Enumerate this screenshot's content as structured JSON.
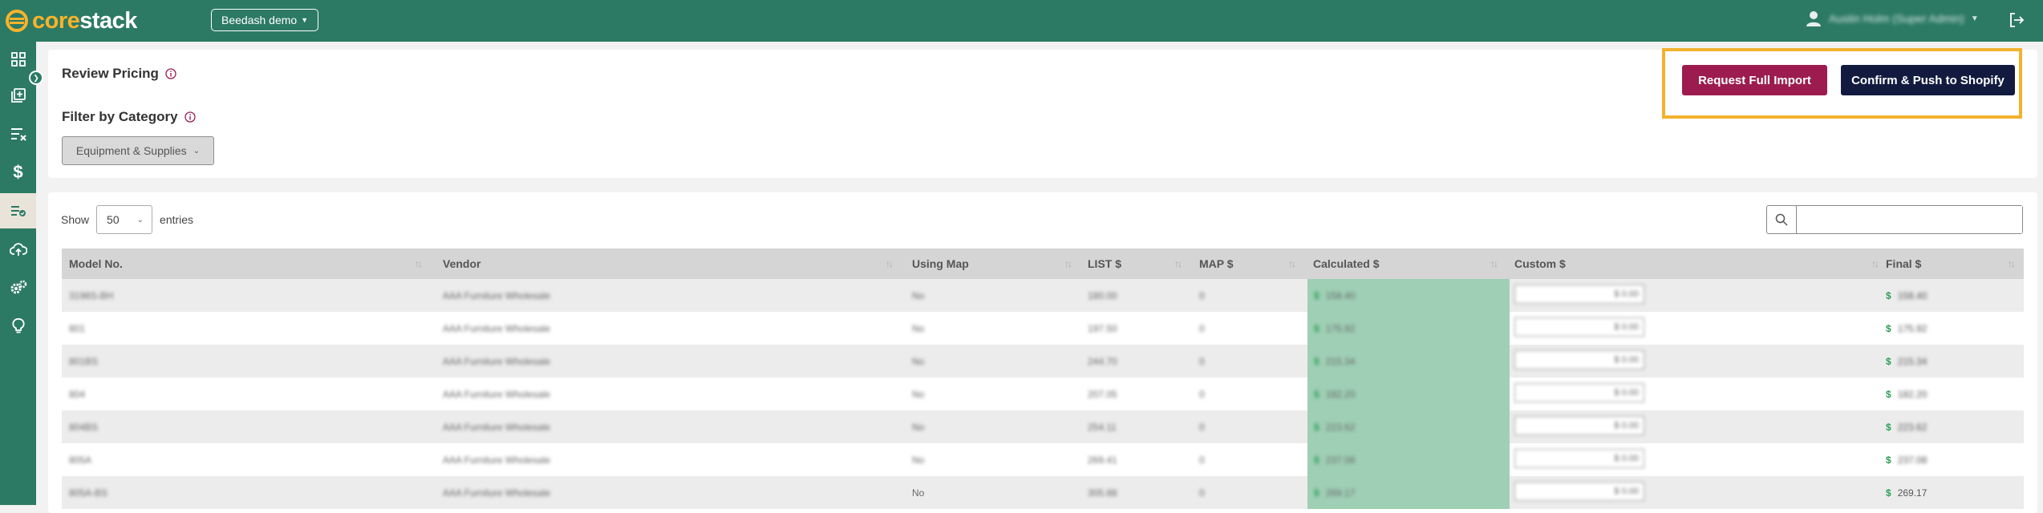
{
  "brand": {
    "core": "core",
    "stack": "stack",
    "logo_color": "#f7b32b"
  },
  "header": {
    "org_select": "Beedash demo",
    "user_name": "Austin Holm (Super Admin)"
  },
  "colors": {
    "topbar": "#2c7a64",
    "import_button": "#9c1c4f",
    "push_button": "#121b3f",
    "highlight": "#f2b22f",
    "calculated": "#9fcfb5"
  },
  "sidebar": {
    "items": [
      {
        "icon": "dashboard-icon"
      },
      {
        "icon": "catalog-icon"
      },
      {
        "icon": "sort-filter-icon"
      },
      {
        "icon": "dollar-icon"
      },
      {
        "icon": "review-list-icon",
        "active": true
      },
      {
        "icon": "cloud-upload-icon"
      },
      {
        "icon": "settings-gears-icon"
      },
      {
        "icon": "lightbulb-icon"
      }
    ]
  },
  "review": {
    "title": "Review Pricing",
    "filter_title": "Filter by Category",
    "category": "Equipment & Supplies",
    "request_import": "Request Full Import",
    "confirm_push": "Confirm & Push to Shopify"
  },
  "table_controls": {
    "show": "Show",
    "entries_value": "50",
    "entries": "entries",
    "search_placeholder": ""
  },
  "table": {
    "columns": [
      "Model No.",
      "Vendor",
      "Using Map",
      "LIST $",
      "MAP $",
      "Calculated $",
      "Custom $",
      "Final $"
    ],
    "rows": [
      {
        "model": "3198S-BH",
        "vendor": "AAA Furniture Wholesale",
        "using_map": "No",
        "list": "180.00",
        "map": "0",
        "calculated": "158.40",
        "custom": "$ 0.00",
        "final": "158.40"
      },
      {
        "model": "801",
        "vendor": "AAA Furniture Wholesale",
        "using_map": "No",
        "list": "197.50",
        "map": "0",
        "calculated": "175.92",
        "custom": "$ 0.00",
        "final": "175.92"
      },
      {
        "model": "801BS",
        "vendor": "AAA Furniture Wholesale",
        "using_map": "No",
        "list": "244.70",
        "map": "0",
        "calculated": "215.34",
        "custom": "$ 0.00",
        "final": "215.34"
      },
      {
        "model": "804",
        "vendor": "AAA Furniture Wholesale",
        "using_map": "No",
        "list": "207.05",
        "map": "0",
        "calculated": "182.20",
        "custom": "$ 0.00",
        "final": "182.20"
      },
      {
        "model": "804BS",
        "vendor": "AAA Furniture Wholesale",
        "using_map": "No",
        "list": "254.11",
        "map": "0",
        "calculated": "223.62",
        "custom": "$ 0.00",
        "final": "223.62"
      },
      {
        "model": "805A",
        "vendor": "AAA Furniture Wholesale",
        "using_map": "No",
        "list": "269.41",
        "map": "0",
        "calculated": "237.08",
        "custom": "$ 0.00",
        "final": "237.08"
      },
      {
        "model": "805A-BS",
        "vendor": "AAA Furniture Wholesale",
        "using_map": "No",
        "list": "305.88",
        "map": "0",
        "calculated": "269.17",
        "custom": "$ 0.00",
        "final": "269.17"
      }
    ]
  }
}
